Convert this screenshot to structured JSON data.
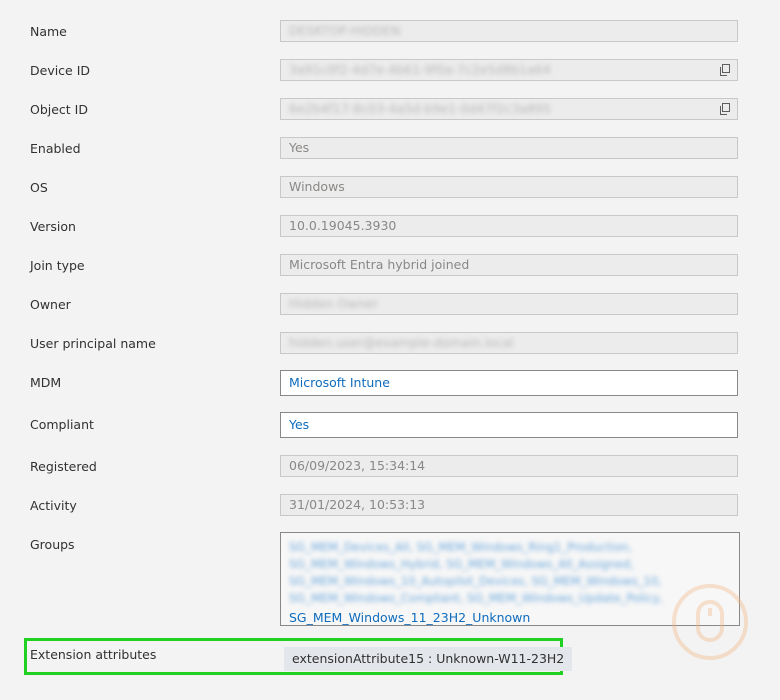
{
  "fields": {
    "name": {
      "label": "Name",
      "value": "DESKTOP-HIDDEN"
    },
    "device_id": {
      "label": "Device ID",
      "value": "3a91c0f2-4d7e-4b61-9f0a-7c2e5d8b1a64"
    },
    "object_id": {
      "label": "Object ID",
      "value": "6e2b4f17-8c03-4a5d-b9e1-0d47f2c3a895"
    },
    "enabled": {
      "label": "Enabled",
      "value": "Yes"
    },
    "os": {
      "label": "OS",
      "value": "Windows"
    },
    "version": {
      "label": "Version",
      "value": "10.0.19045.3930"
    },
    "join_type": {
      "label": "Join type",
      "value": "Microsoft Entra hybrid joined"
    },
    "owner": {
      "label": "Owner",
      "value": "Hidden Owner"
    },
    "upn": {
      "label": "User principal name",
      "value": "hidden.user@example-domain.local"
    },
    "mdm": {
      "label": "MDM",
      "value": "Microsoft Intune"
    },
    "compliant": {
      "label": "Compliant",
      "value": "Yes"
    },
    "registered": {
      "label": "Registered",
      "value": "06/09/2023, 15:34:14"
    },
    "activity": {
      "label": "Activity",
      "value": "31/01/2024, 10:53:13"
    }
  },
  "groups": {
    "label": "Groups",
    "items": [
      "SG_MEM_Devices_All, SG_MEM_Windows_Ring1_Production,",
      "SG_MEM_Windows_Hybrid, SG_MEM_Windows_All_Assigned,",
      "SG_MEM_Windows_10_Autopilot_Devices, SG_MEM_Windows_10,",
      "SG_MEM_Windows_Compliant, SG_MEM_Windows_Update_Policy,",
      "SG_MEM_Windows_11_23H2_Unknown"
    ]
  },
  "extension": {
    "label": "Extension attributes",
    "value": "extensionAttribute15 : Unknown-W11-23H2"
  },
  "colors": {
    "link": "#0f6cbd",
    "highlight": "#22d022"
  },
  "icons": {
    "copy": "copy-icon",
    "watermark": "mouse-logo-icon"
  }
}
